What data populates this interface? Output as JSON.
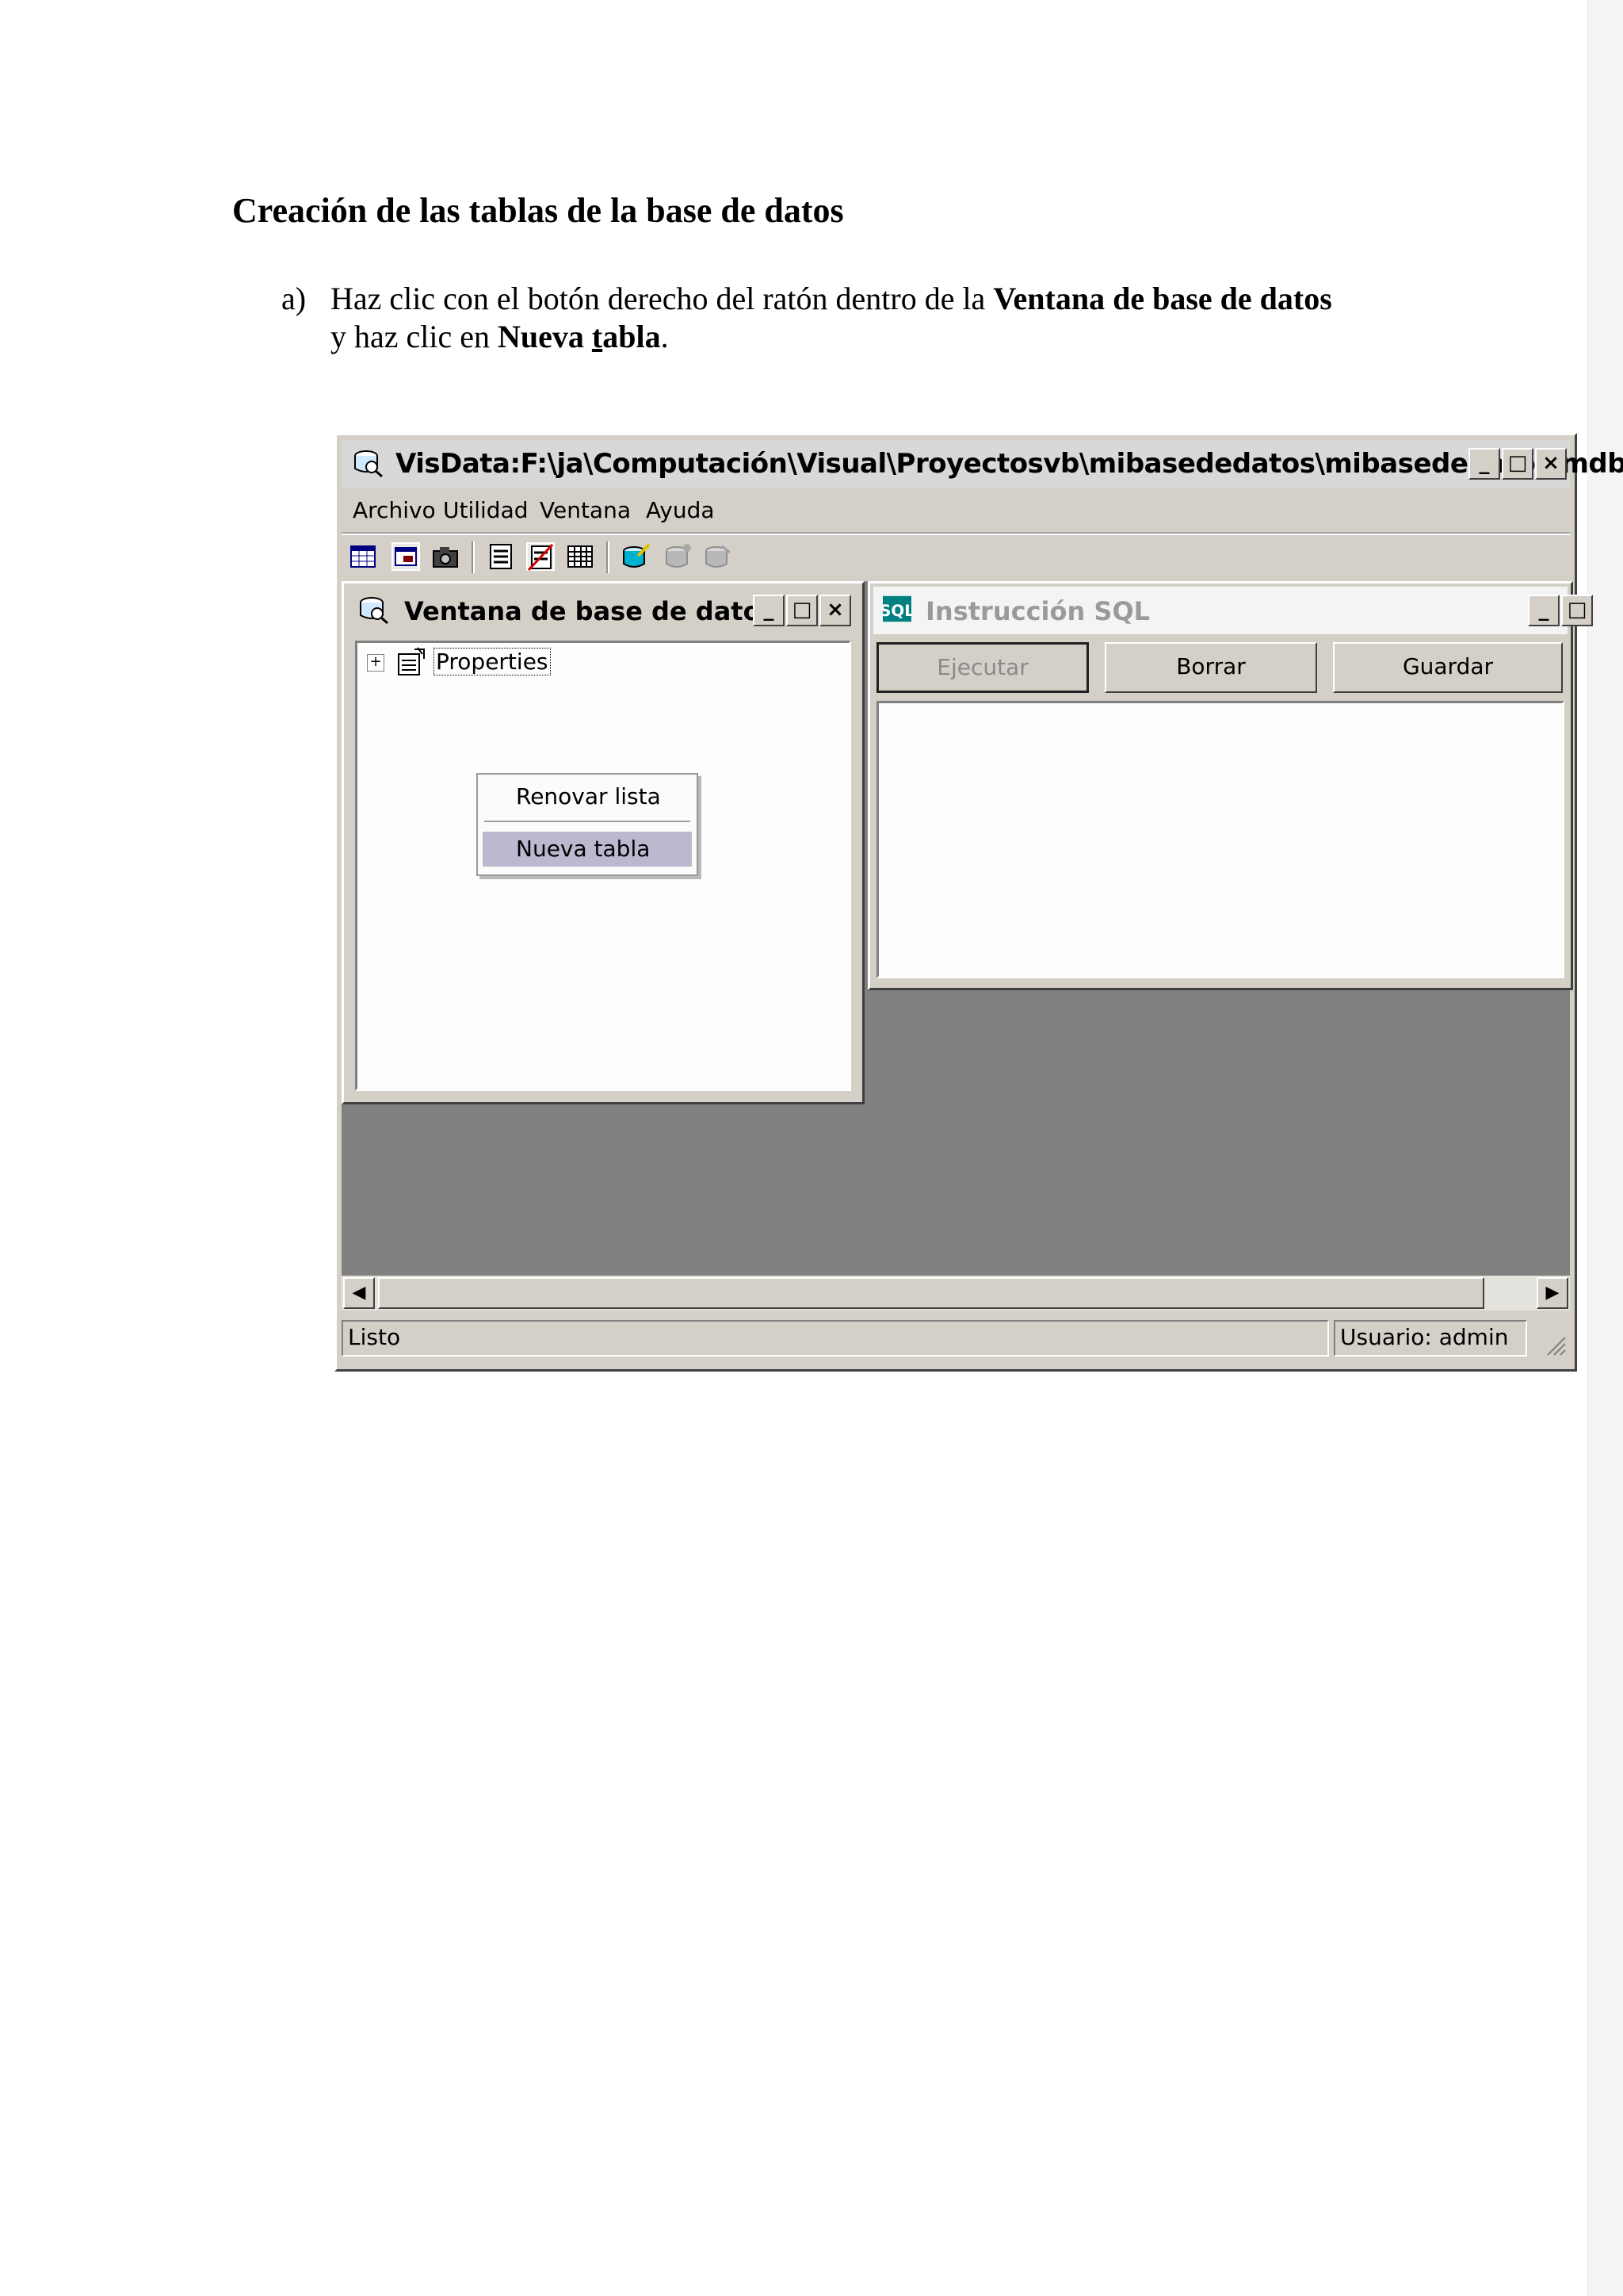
{
  "document": {
    "heading": "Creación de las tablas de la base de datos",
    "step_marker": "a)",
    "line1_prefix": "Haz clic con el botón derecho del ratón dentro de la ",
    "line1_bold": "Ventana de base de datos",
    "line2_prefix": "y haz clic en ",
    "line2_bold_a": "Nueva ",
    "line2_bold_u": "t",
    "line2_bold_b": "abla",
    "line2_suffix": "."
  },
  "window": {
    "title": "VisData:F:\\ja\\Computación\\Visual\\Proyectosvb\\mibasededatos\\mibasededatos.mdb",
    "caption_buttons": {
      "minimize": "_",
      "maximize": "□",
      "close": "×"
    },
    "menu": [
      "Archivo",
      "Utilidad",
      "Ventana",
      "Ayuda"
    ],
    "toolbar_icons": [
      "table-type-icon",
      "dynaset-icon",
      "snapshot-icon",
      "data-control-icon",
      "no-data-control-icon",
      "grid-icon",
      "begin-transaction-icon",
      "commit-icon",
      "rollback-icon"
    ]
  },
  "db_window": {
    "title": "Ventana de base de datos",
    "tree_expander": "+",
    "tree_item": "Properties",
    "context_menu": [
      "Renovar lista",
      "Nueva tabla"
    ]
  },
  "sql_window": {
    "title": "Instrucción SQL",
    "buttons": [
      "Ejecutar",
      "Borrar",
      "Guardar"
    ]
  },
  "scrollbar": {
    "left_arrow": "◀",
    "right_arrow": "▶"
  },
  "status": {
    "left": "Listo",
    "right": "Usuario: admin"
  },
  "colors": {
    "mdi_background": "#808080",
    "menu_highlight": "#bdb8d0",
    "sql_icon": "#008080"
  }
}
